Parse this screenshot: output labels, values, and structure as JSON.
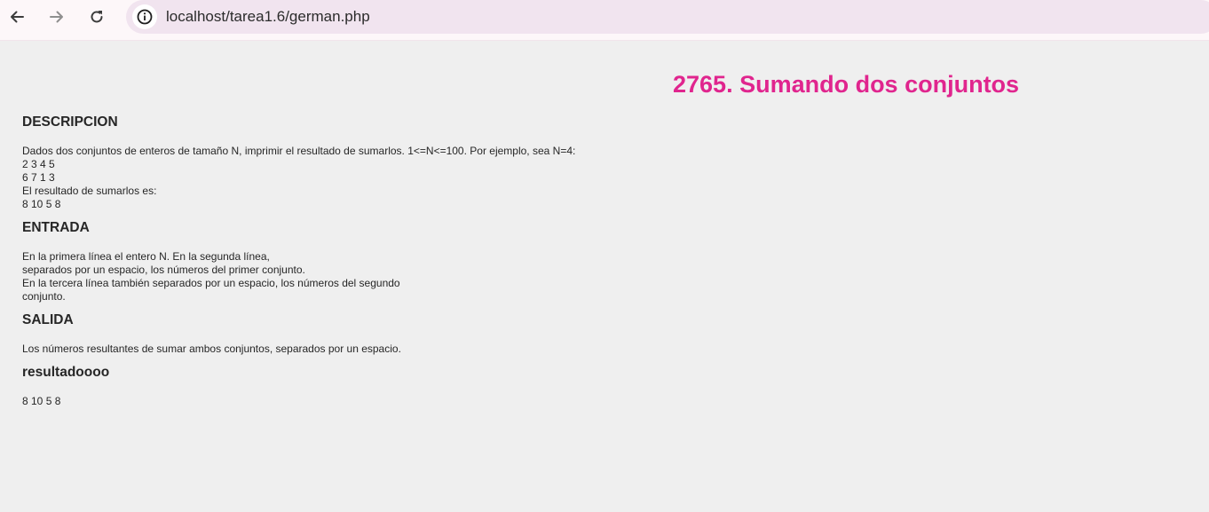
{
  "browser": {
    "url": "localhost/tarea1.6/german.php"
  },
  "page": {
    "title": "2765. Sumando dos conjuntos",
    "sections": [
      {
        "heading": "DESCRIPCION",
        "text": "Dados dos conjuntos de enteros de tamaño N, imprimir el resultado de sumarlos. 1<=N<=100. Por ejemplo, sea N=4:\n2 3 4 5\n6 7 1 3\nEl resultado de sumarlos es:\n8 10 5 8"
      },
      {
        "heading": "ENTRADA",
        "text": "En la primera línea el entero N. En la segunda línea,\nseparados por un espacio, los números del primer conjunto.\nEn la tercera línea también separados por un espacio, los números del segundo\nconjunto."
      },
      {
        "heading": "SALIDA",
        "text": "Los números resultantes de sumar ambos conjuntos, separados por un espacio."
      },
      {
        "heading": "resultadoooo",
        "text": "8 10 5 8"
      }
    ]
  },
  "colors": {
    "title": "#e0258e",
    "background": "#efefef"
  },
  "icons": {
    "back": "arrow-left-icon",
    "forward": "arrow-right-icon",
    "reload": "reload-icon",
    "site_info": "info-icon"
  }
}
